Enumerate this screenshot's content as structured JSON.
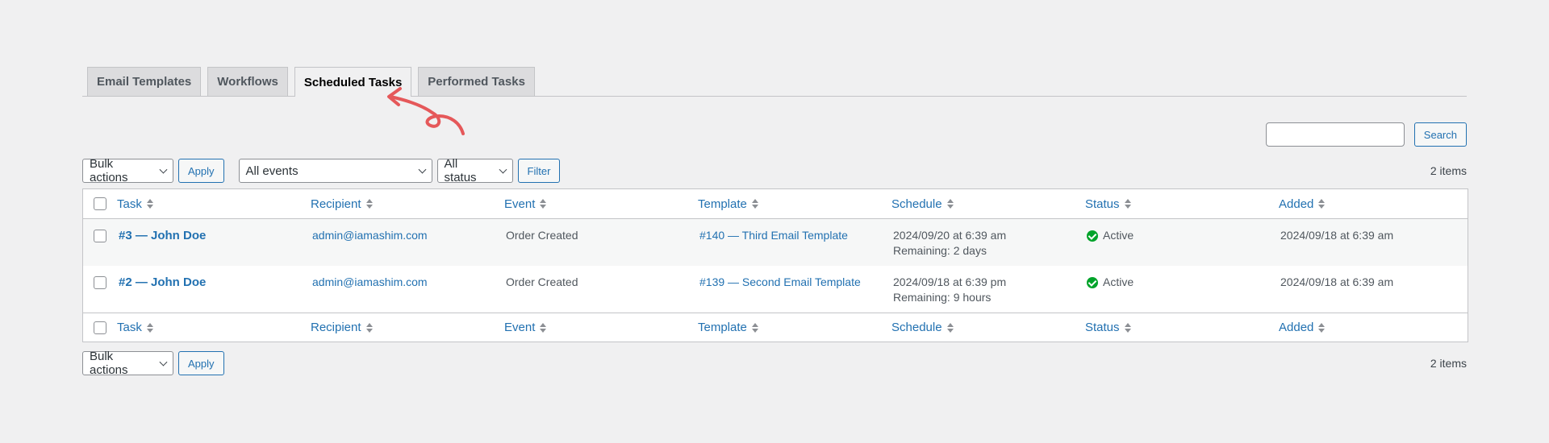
{
  "tabs": [
    {
      "label": "Email Templates",
      "active": false
    },
    {
      "label": "Workflows",
      "active": false
    },
    {
      "label": "Scheduled Tasks",
      "active": true
    },
    {
      "label": "Performed Tasks",
      "active": false
    }
  ],
  "search": {
    "button_label": "Search",
    "value": ""
  },
  "top_nav": {
    "bulk_actions": "Bulk actions",
    "apply": "Apply",
    "events_filter": "All events",
    "status_filter": "All status",
    "filter": "Filter",
    "count": "2 items"
  },
  "bottom_nav": {
    "bulk_actions": "Bulk actions",
    "apply": "Apply",
    "count": "2 items"
  },
  "columns": [
    "Task",
    "Recipient",
    "Event",
    "Template",
    "Schedule",
    "Status",
    "Added"
  ],
  "rows": [
    {
      "task": "#3 — John Doe",
      "recipient": "admin@iamashim.com",
      "event": "Order Created",
      "template": "#140 — Third Email Template",
      "schedule": "2024/09/20 at 6:39 am",
      "remaining": "Remaining: 2 days",
      "status": "Active",
      "added": "2024/09/18 at 6:39 am"
    },
    {
      "task": "#2 — John Doe",
      "recipient": "admin@iamashim.com",
      "event": "Order Created",
      "template": "#139 — Second Email Template",
      "schedule": "2024/09/18 at 6:39 pm",
      "remaining": "Remaining: 9 hours",
      "status": "Active",
      "added": "2024/09/18 at 6:39 am"
    }
  ],
  "colors": {
    "link": "#2271b1",
    "status_active": "#00a32a",
    "annotation": "#e5585a"
  }
}
